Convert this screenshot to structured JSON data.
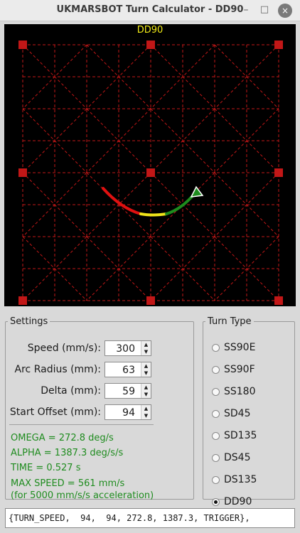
{
  "window": {
    "title": "UKMARSBOT Turn Calculator - DD90"
  },
  "window_controls": {
    "minimize": "–",
    "maximize": "□",
    "close": "×"
  },
  "canvas": {
    "title": "DD90",
    "title_color": "#f2ec17",
    "grid_color": "#c21717",
    "path_colors": [
      "#e01010",
      "#f0e41a",
      "#1e8c1e"
    ]
  },
  "settings": {
    "legend": "Settings",
    "fields": [
      {
        "label": "Speed (mm/s):",
        "value": "300"
      },
      {
        "label": "Arc Radius (mm):",
        "value": "63"
      },
      {
        "label": "Delta (mm):",
        "value": "59"
      },
      {
        "label": "Start Offset (mm):",
        "value": "94"
      }
    ],
    "spin_up": "▲",
    "spin_down": "▼",
    "results": [
      "OMEGA = 272.8 deg/s",
      "ALPHA = 1387.3 deg/s/s",
      "TIME = 0.527 s",
      "MAX SPEED =  561 mm/s",
      "(for 5000 mm/s/s acceleration)"
    ],
    "result_color": "#1f8c1f"
  },
  "turn_type": {
    "legend": "Turn Type",
    "options": [
      {
        "label": "SS90E",
        "selected": false
      },
      {
        "label": "SS90F",
        "selected": false
      },
      {
        "label": "SS180",
        "selected": false
      },
      {
        "label": "SD45",
        "selected": false
      },
      {
        "label": "SD135",
        "selected": false
      },
      {
        "label": "DS45",
        "selected": false
      },
      {
        "label": "DS135",
        "selected": false
      },
      {
        "label": "DD90",
        "selected": true
      }
    ]
  },
  "output": {
    "text": "{TURN_SPEED,  94,  94, 272.8, 1387.3, TRIGGER},"
  }
}
